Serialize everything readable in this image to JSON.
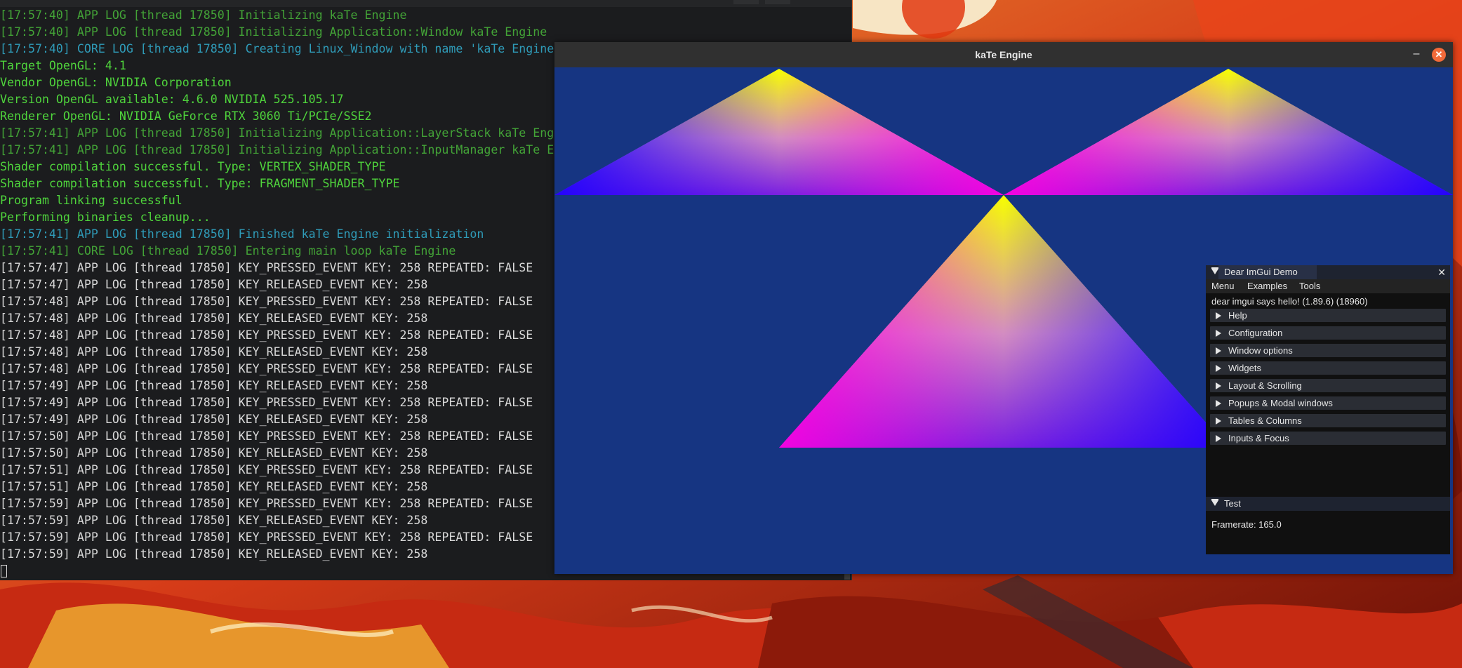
{
  "terminal": {
    "lines": [
      {
        "text": "[17:57:40] APP LOG [thread 17850] Initializing kaTe Engine",
        "color": "#43a337"
      },
      {
        "text": "[17:57:40] APP LOG [thread 17850] Initializing Application::Window kaTe Engine",
        "color": "#43a337"
      },
      {
        "text": "[17:57:40] CORE LOG [thread 17850] Creating Linux_Window with name 'kaTe Engine",
        "color": "#2f9bb8"
      },
      {
        "text": "Target OpenGL: 4.1",
        "color": "#4fd43c"
      },
      {
        "text": "Vendor OpenGL: NVIDIA Corporation",
        "color": "#4fd43c"
      },
      {
        "text": "Version OpenGL available: 4.6.0 NVIDIA 525.105.17",
        "color": "#4fd43c"
      },
      {
        "text": "Renderer OpenGL: NVIDIA GeForce RTX 3060 Ti/PCIe/SSE2",
        "color": "#4fd43c"
      },
      {
        "text": "[17:57:41] APP LOG [thread 17850] Initializing Application::LayerStack kaTe Eng",
        "color": "#43a337"
      },
      {
        "text": "[17:57:41] APP LOG [thread 17850] Initializing Application::InputManager kaTe E",
        "color": "#43a337"
      },
      {
        "text": "Shader compilation successful. Type: VERTEX_SHADER_TYPE",
        "color": "#4fd43c"
      },
      {
        "text": "Shader compilation successful. Type: FRAGMENT_SHADER_TYPE",
        "color": "#4fd43c"
      },
      {
        "text": "Program linking successful",
        "color": "#4fd43c"
      },
      {
        "text": "Performing binaries cleanup...",
        "color": "#4fd43c"
      },
      {
        "text": "[17:57:41] APP LOG [thread 17850] Finished kaTe Engine initialization",
        "color": "#2f9bb8"
      },
      {
        "text": "[17:57:41] CORE LOG [thread 17850] Entering main loop kaTe Engine",
        "color": "#43a337"
      },
      {
        "text": "[17:57:47] APP LOG [thread 17850] KEY_PRESSED_EVENT KEY: 258 REPEATED: FALSE",
        "color": "#d8d8d8"
      },
      {
        "text": "[17:57:47] APP LOG [thread 17850] KEY_RELEASED_EVENT KEY: 258",
        "color": "#d8d8d8"
      },
      {
        "text": "[17:57:48] APP LOG [thread 17850] KEY_PRESSED_EVENT KEY: 258 REPEATED: FALSE",
        "color": "#d8d8d8"
      },
      {
        "text": "[17:57:48] APP LOG [thread 17850] KEY_RELEASED_EVENT KEY: 258",
        "color": "#d8d8d8"
      },
      {
        "text": "[17:57:48] APP LOG [thread 17850] KEY_PRESSED_EVENT KEY: 258 REPEATED: FALSE",
        "color": "#d8d8d8"
      },
      {
        "text": "[17:57:48] APP LOG [thread 17850] KEY_RELEASED_EVENT KEY: 258",
        "color": "#d8d8d8"
      },
      {
        "text": "[17:57:48] APP LOG [thread 17850] KEY_PRESSED_EVENT KEY: 258 REPEATED: FALSE",
        "color": "#d8d8d8"
      },
      {
        "text": "[17:57:49] APP LOG [thread 17850] KEY_RELEASED_EVENT KEY: 258",
        "color": "#d8d8d8"
      },
      {
        "text": "[17:57:49] APP LOG [thread 17850] KEY_PRESSED_EVENT KEY: 258 REPEATED: FALSE",
        "color": "#d8d8d8"
      },
      {
        "text": "[17:57:49] APP LOG [thread 17850] KEY_RELEASED_EVENT KEY: 258",
        "color": "#d8d8d8"
      },
      {
        "text": "[17:57:50] APP LOG [thread 17850] KEY_PRESSED_EVENT KEY: 258 REPEATED: FALSE",
        "color": "#d8d8d8"
      },
      {
        "text": "[17:57:50] APP LOG [thread 17850] KEY_RELEASED_EVENT KEY: 258",
        "color": "#d8d8d8"
      },
      {
        "text": "[17:57:51] APP LOG [thread 17850] KEY_PRESSED_EVENT KEY: 258 REPEATED: FALSE",
        "color": "#d8d8d8"
      },
      {
        "text": "[17:57:51] APP LOG [thread 17850] KEY_RELEASED_EVENT KEY: 258",
        "color": "#d8d8d8"
      },
      {
        "text": "[17:57:59] APP LOG [thread 17850] KEY_PRESSED_EVENT KEY: 258 REPEATED: FALSE",
        "color": "#d8d8d8"
      },
      {
        "text": "[17:57:59] APP LOG [thread 17850] KEY_RELEASED_EVENT KEY: 258",
        "color": "#d8d8d8"
      },
      {
        "text": "[17:57:59] APP LOG [thread 17850] KEY_PRESSED_EVENT KEY: 258 REPEATED: FALSE",
        "color": "#d8d8d8"
      },
      {
        "text": "[17:57:59] APP LOG [thread 17850] KEY_RELEASED_EVENT KEY: 258",
        "color": "#d8d8d8"
      }
    ]
  },
  "window": {
    "title": "kaTe Engine",
    "minimize_glyph": "–",
    "close_glyph": "✕",
    "viewport_color": "#163582"
  },
  "imgui": {
    "title": "Dear ImGui Demo",
    "close_glyph": "✕",
    "menu": [
      "Menu",
      "Examples",
      "Tools"
    ],
    "hello_text": "dear imgui says hello! (1.89.6) (18960)",
    "headers": [
      "Help",
      "Configuration",
      "Window options",
      "Widgets",
      "Layout & Scrolling",
      "Popups & Modal windows",
      "Tables & Columns",
      "Inputs & Focus"
    ],
    "test_title": "Test",
    "framerate_text": "Framerate: 165.0"
  }
}
